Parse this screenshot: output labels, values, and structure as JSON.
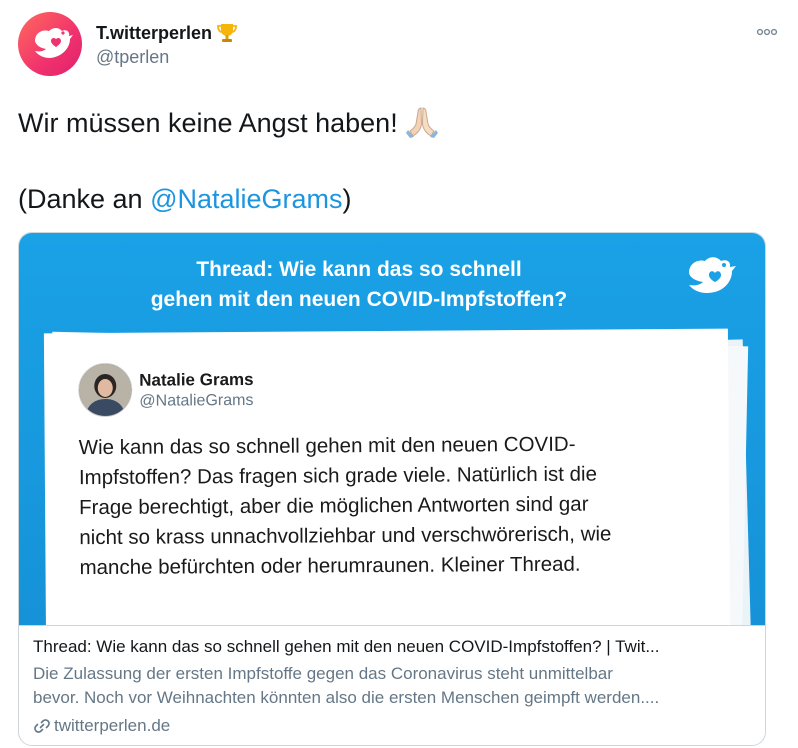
{
  "author": {
    "display_name": "T.witterperlen",
    "handle": "@tperlen",
    "badge_icon": "trophy-icon",
    "avatar_colors": [
      "#ff6a5c",
      "#e01f6a"
    ]
  },
  "menu_icon": "more-options-icon",
  "tweet": {
    "line1": "Wir müssen keine Angst haben!",
    "line1_emoji": "folded-hands-icon",
    "line2_prefix": "(Danke an ",
    "mention": "@NatalieGrams",
    "line2_suffix": ")"
  },
  "card": {
    "image": {
      "title_line1": "Thread: Wie kann das so schnell",
      "title_line2": "gehen mit den neuen COVID-Impfstoffen?",
      "bird_icon": "twitter-bird-icon",
      "background": "#1aa1e6",
      "quoted": {
        "name": "Natalie Grams",
        "handle": "@NatalieGrams",
        "text_lines": [
          "Wie kann das so schnell gehen mit den neuen COVID-",
          "Impfstoffen? Das fragen sich grade viele. Natürlich ist die",
          "Frage berechtigt, aber die möglichen Antworten sind gar",
          "nicht so krass unnachvollziehbar und verschwörerisch, wie",
          "manche befürchten oder herumraunen. Kleiner Thread."
        ]
      }
    },
    "link_title": "Thread: Wie kann das so schnell gehen mit den neuen COVID-Impfstoffen? | Twit...",
    "link_desc_lines": [
      "Die Zulassung der ersten Impfstoffe gegen das Coronavirus steht unmittelbar",
      "bevor. Noch vor Weihnachten könnten also die ersten Menschen geimpft werden...."
    ],
    "domain": "twitterperlen.de",
    "domain_icon": "link-icon"
  },
  "colors": {
    "link": "#1b95e0",
    "secondary_text": "#657786",
    "card_blue": "#1aa1e6"
  }
}
